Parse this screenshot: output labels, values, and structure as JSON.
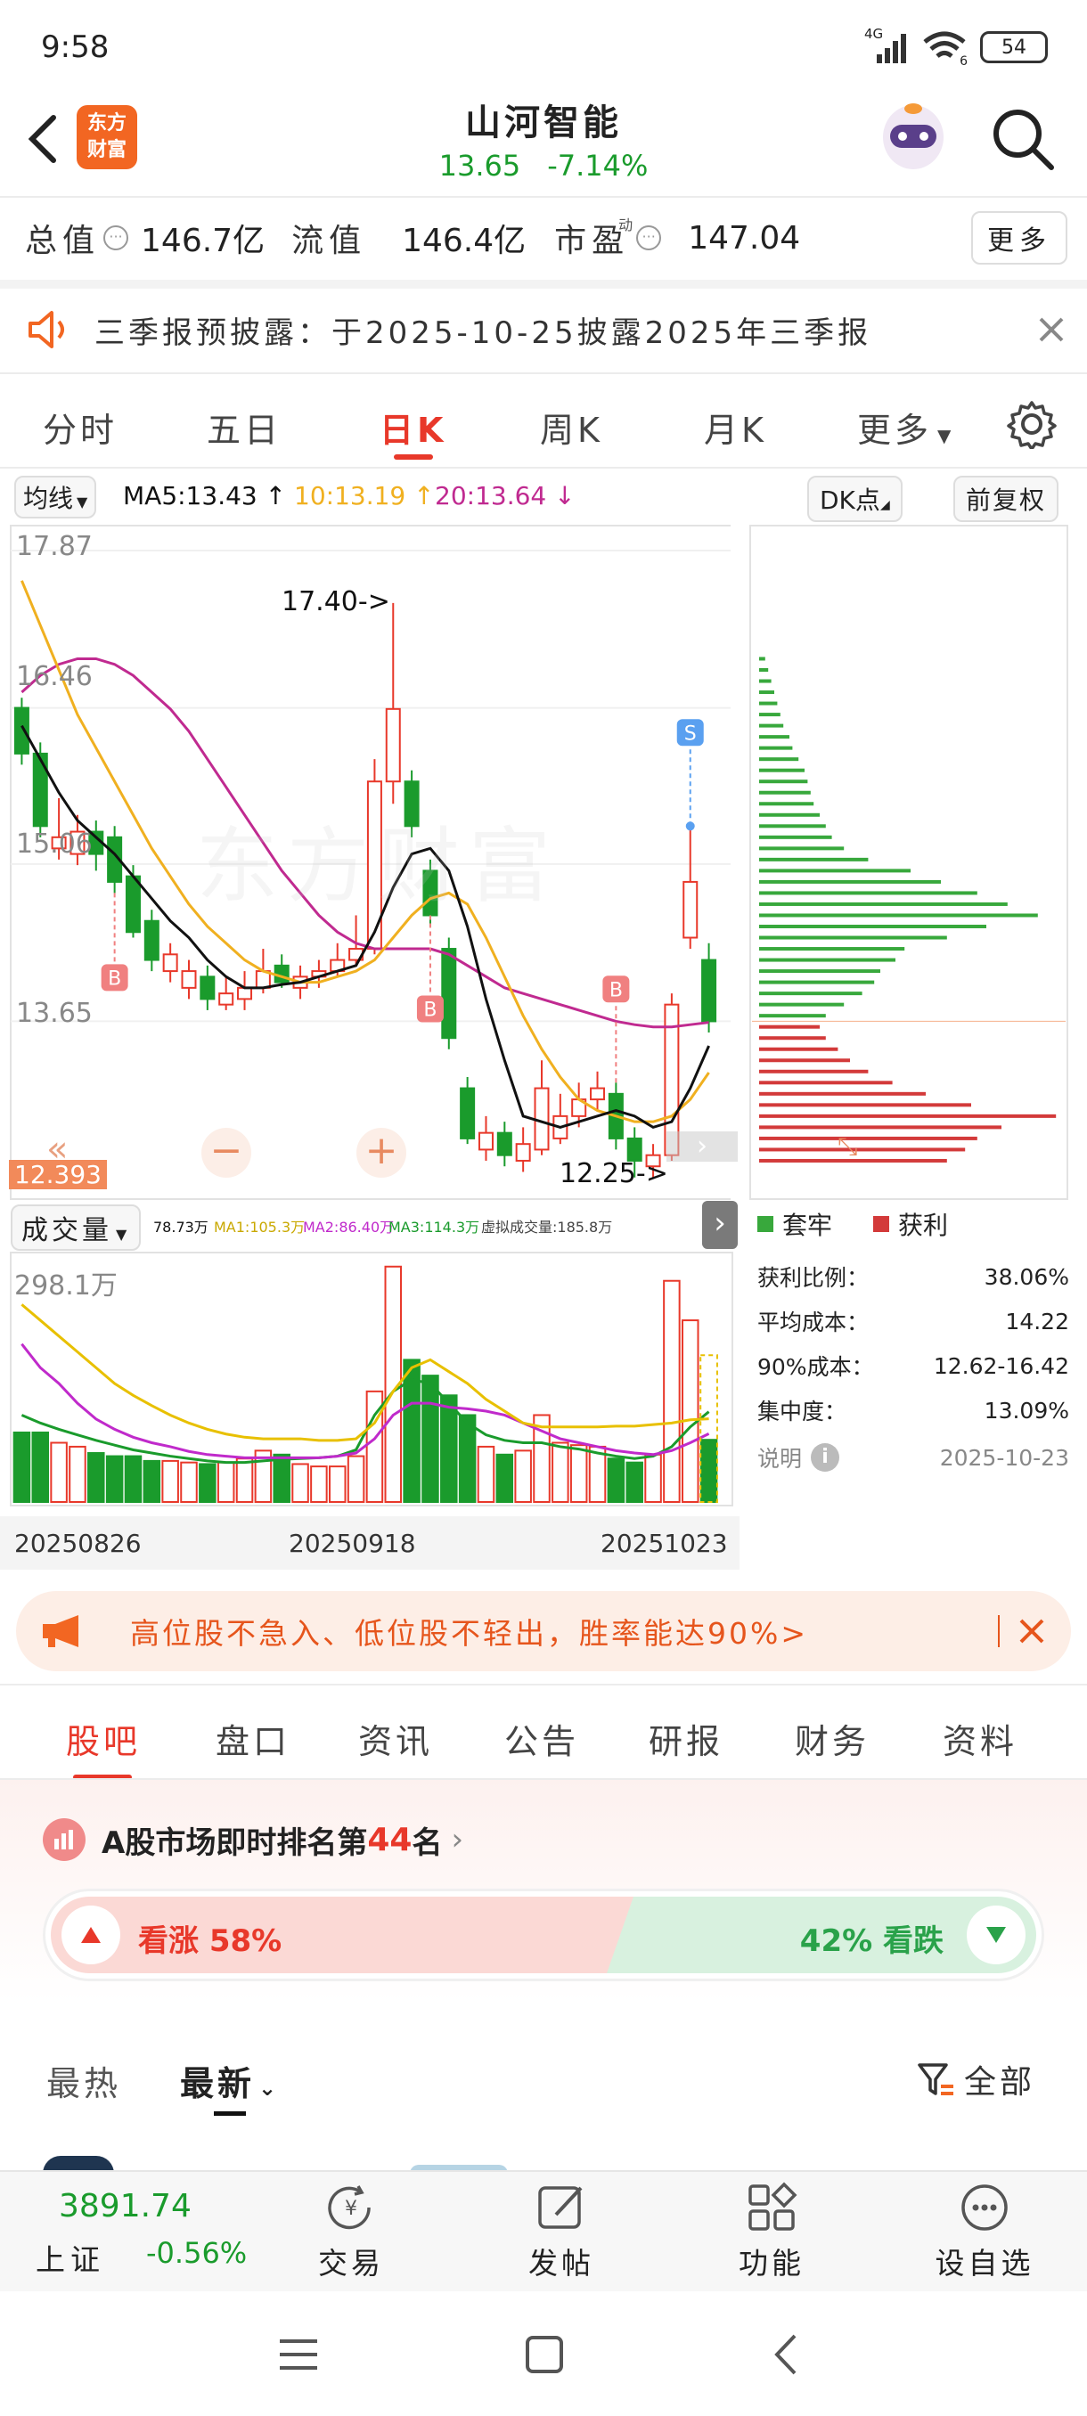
{
  "status_bar": {
    "time": "9:58",
    "network": "4G",
    "wifi_badge": "6",
    "battery": "54"
  },
  "header": {
    "brand_logo_text": "东方财富",
    "title": "山河智能",
    "price": "13.65",
    "change": "-7.14%"
  },
  "stats": {
    "total_label": "总值",
    "total_value": "146.7亿",
    "float_label": "流值",
    "float_value": "146.4亿",
    "pe_label": "市盈",
    "pe_superscript": "动",
    "pe_value": "147.04",
    "more_label": "更多"
  },
  "notice": {
    "text": "三季报预披露：于2025-10-25披露2025年三季报"
  },
  "chart_tabs": [
    "分时",
    "五日",
    "日K",
    "周K",
    "月K",
    "更多"
  ],
  "indicator_bar": {
    "ma_selector": "均线",
    "ma5": "MA5:13.43",
    "ma10": "10:13.19",
    "ma20": "20:13.64",
    "dk_button": "DK点",
    "adjust_button": "前复权"
  },
  "price_axis": [
    "17.87",
    "16.46",
    "15.06",
    "13.65",
    "12.393"
  ],
  "annotations": {
    "high": "17.40->",
    "low": "12.25->",
    "buy_marker": "B",
    "sell_marker": "S",
    "watermark": "东方财富"
  },
  "volume_bar": {
    "label": "成交量",
    "vol": "78.73万",
    "ma1": "MA1:105.3万",
    "ma2": "MA2:86.40万",
    "ma3": "MA3:114.3万",
    "virtual": "虚拟成交量:185.8万",
    "axis_max": "298.1万"
  },
  "dates": [
    "20250826",
    "20250918",
    "20251023"
  ],
  "chip_panel": {
    "legend_trapped": "套牢",
    "legend_profit": "获利",
    "rows": [
      {
        "label": "获利比例：",
        "value": "38.06%"
      },
      {
        "label": "平均成本：",
        "value": "14.22"
      },
      {
        "label": "90%成本：",
        "value": "12.62-16.42"
      },
      {
        "label": "集中度：",
        "value": "13.09%"
      }
    ],
    "explain": "说明",
    "date": "2025-10-23"
  },
  "promo": {
    "text": "高位股不急入、低位股不轻出，胜率能达90%>"
  },
  "section_tabs": [
    "股吧",
    "盘口",
    "资讯",
    "公告",
    "研报",
    "财务",
    "资料"
  ],
  "ranking": {
    "prefix": "A股市场即时排名第",
    "rank": "44",
    "suffix": "名"
  },
  "sentiment": {
    "up_label": "看涨 58%",
    "down_label": "42% 看跌",
    "up_fraction": 0.58
  },
  "feed_filter": {
    "hot": "最热",
    "latest": "最新",
    "all": "全部"
  },
  "bottom_bar": {
    "index_value": "3891.74",
    "index_name": "上证",
    "index_change": "-0.56%",
    "trade": "交易",
    "post": "发帖",
    "functions": "功能",
    "watchlist": "设自选"
  },
  "colors": {
    "up": "#e8382a",
    "down": "#1a9b2c",
    "ma5": "#111111",
    "ma10": "#f0b020",
    "ma20": "#c02a90",
    "accent": "#e8382a"
  },
  "chart_data": {
    "type": "candlestick",
    "candles": [
      {
        "o": 16.46,
        "c": 16.05,
        "h": 16.55,
        "l": 15.95
      },
      {
        "o": 16.05,
        "c": 15.4,
        "h": 16.15,
        "l": 15.3
      },
      {
        "o": 15.2,
        "c": 15.3,
        "h": 15.65,
        "l": 15.1
      },
      {
        "o": 15.15,
        "c": 15.35,
        "h": 15.5,
        "l": 15.05
      },
      {
        "o": 15.35,
        "c": 15.15,
        "h": 15.45,
        "l": 15.0
      },
      {
        "o": 15.3,
        "c": 14.9,
        "h": 15.4,
        "l": 14.8
      },
      {
        "o": 14.95,
        "c": 14.45,
        "h": 15.05,
        "l": 14.4
      },
      {
        "o": 14.55,
        "c": 14.2,
        "h": 14.65,
        "l": 14.1
      },
      {
        "o": 14.1,
        "c": 14.25,
        "h": 14.35,
        "l": 14.0
      },
      {
        "o": 13.95,
        "c": 14.1,
        "h": 14.2,
        "l": 13.85
      },
      {
        "o": 14.05,
        "c": 13.85,
        "h": 14.15,
        "l": 13.75
      },
      {
        "o": 13.8,
        "c": 13.9,
        "h": 14.05,
        "l": 13.75
      },
      {
        "o": 13.85,
        "c": 13.95,
        "h": 14.1,
        "l": 13.75
      },
      {
        "o": 13.95,
        "c": 14.1,
        "h": 14.3,
        "l": 13.9
      },
      {
        "o": 14.15,
        "c": 14.0,
        "h": 14.25,
        "l": 13.95
      },
      {
        "o": 13.95,
        "c": 14.05,
        "h": 14.15,
        "l": 13.85
      },
      {
        "o": 14.05,
        "c": 14.1,
        "h": 14.2,
        "l": 13.95
      },
      {
        "o": 14.1,
        "c": 14.2,
        "h": 14.35,
        "l": 14.05
      },
      {
        "o": 14.2,
        "c": 14.3,
        "h": 14.6,
        "l": 14.15
      },
      {
        "o": 14.3,
        "c": 15.8,
        "h": 16.0,
        "l": 14.25
      },
      {
        "o": 15.8,
        "c": 16.45,
        "h": 17.4,
        "l": 15.6
      },
      {
        "o": 15.8,
        "c": 15.4,
        "h": 15.9,
        "l": 15.3
      },
      {
        "o": 15.0,
        "c": 14.6,
        "h": 15.1,
        "l": 14.5
      },
      {
        "o": 14.3,
        "c": 13.5,
        "h": 14.4,
        "l": 13.4
      },
      {
        "o": 13.05,
        "c": 12.6,
        "h": 13.15,
        "l": 12.55
      },
      {
        "o": 12.5,
        "c": 12.65,
        "h": 12.8,
        "l": 12.4
      },
      {
        "o": 12.65,
        "c": 12.45,
        "h": 12.75,
        "l": 12.35
      },
      {
        "o": 12.4,
        "c": 12.55,
        "h": 12.7,
        "l": 12.3
      },
      {
        "o": 12.5,
        "c": 13.05,
        "h": 13.3,
        "l": 12.45
      },
      {
        "o": 12.6,
        "c": 12.8,
        "h": 13.0,
        "l": 12.55
      },
      {
        "o": 12.8,
        "c": 12.95,
        "h": 13.1,
        "l": 12.7
      },
      {
        "o": 12.95,
        "c": 13.05,
        "h": 13.2,
        "l": 12.85
      },
      {
        "o": 13.0,
        "c": 12.6,
        "h": 13.1,
        "l": 12.5
      },
      {
        "o": 12.6,
        "c": 12.4,
        "h": 12.7,
        "l": 12.25
      },
      {
        "o": 12.35,
        "c": 12.45,
        "h": 12.55,
        "l": 12.25
      },
      {
        "o": 12.45,
        "c": 13.8,
        "h": 13.9,
        "l": 12.4
      },
      {
        "o": 14.4,
        "c": 14.9,
        "h": 15.4,
        "l": 14.3
      },
      {
        "o": 14.2,
        "c": 13.65,
        "h": 14.35,
        "l": 13.55
      }
    ],
    "ma5": [
      16.3,
      16.0,
      15.7,
      15.45,
      15.3,
      15.15,
      14.95,
      14.75,
      14.55,
      14.4,
      14.2,
      14.05,
      13.95,
      13.95,
      13.98,
      14.0,
      14.05,
      14.1,
      14.15,
      14.45,
      14.85,
      15.15,
      15.2,
      15.0,
      14.5,
      13.85,
      13.3,
      12.8,
      12.75,
      12.7,
      12.75,
      12.8,
      12.85,
      12.8,
      12.7,
      12.75,
      13.05,
      13.43
    ],
    "ma10": [
      17.6,
      17.2,
      16.8,
      16.4,
      16.1,
      15.8,
      15.5,
      15.2,
      14.95,
      14.7,
      14.5,
      14.35,
      14.2,
      14.1,
      14.05,
      14.0,
      14.0,
      14.05,
      14.1,
      14.2,
      14.4,
      14.6,
      14.75,
      14.8,
      14.7,
      14.4,
      14.05,
      13.7,
      13.4,
      13.15,
      12.95,
      12.85,
      12.8,
      12.75,
      12.75,
      12.8,
      12.95,
      13.19
    ],
    "ma20": [
      16.6,
      16.75,
      16.85,
      16.9,
      16.9,
      16.85,
      16.75,
      16.6,
      16.45,
      16.25,
      16.0,
      15.75,
      15.5,
      15.25,
      15.0,
      14.8,
      14.6,
      14.45,
      14.35,
      14.3,
      14.3,
      14.3,
      14.3,
      14.25,
      14.15,
      14.05,
      13.95,
      13.9,
      13.85,
      13.8,
      13.75,
      13.7,
      13.65,
      13.62,
      13.6,
      13.6,
      13.62,
      13.64
    ],
    "volume": [
      88,
      88,
      75,
      70,
      62,
      58,
      58,
      52,
      52,
      50,
      48,
      50,
      55,
      65,
      60,
      48,
      45,
      45,
      58,
      140,
      298,
      180,
      160,
      135,
      110,
      70,
      60,
      65,
      110,
      75,
      72,
      70,
      55,
      50,
      60,
      280,
      230,
      78.73
    ],
    "vol_ma": {
      "ma1": [
        250,
        230,
        210,
        190,
        170,
        150,
        135,
        122,
        110,
        100,
        92,
        86,
        82,
        80,
        80,
        80,
        78,
        78,
        80,
        100,
        140,
        170,
        180,
        165,
        150,
        130,
        115,
        100,
        95,
        95,
        95,
        95,
        96,
        96,
        98,
        100,
        104,
        105.3
      ],
      "ma2": [
        200,
        170,
        150,
        125,
        105,
        92,
        82,
        75,
        70,
        64,
        60,
        58,
        56,
        56,
        56,
        56,
        56,
        58,
        62,
        80,
        110,
        125,
        125,
        120,
        118,
        115,
        110,
        100,
        90,
        80,
        75,
        70,
        65,
        62,
        60,
        65,
        75,
        86.4
      ],
      "ma3": [
        110,
        100,
        92,
        85,
        78,
        72,
        66,
        62,
        58,
        55,
        52,
        50,
        50,
        52,
        54,
        55,
        56,
        58,
        66,
        110,
        140,
        155,
        150,
        125,
        100,
        85,
        78,
        75,
        75,
        70,
        67,
        62,
        58,
        55,
        58,
        70,
        95,
        114.3
      ]
    },
    "chip_bars": [
      {
        "p": 16.9,
        "w": 2,
        "t": "trapped"
      },
      {
        "p": 16.8,
        "w": 3,
        "t": "trapped"
      },
      {
        "p": 16.7,
        "w": 4,
        "t": "trapped"
      },
      {
        "p": 16.6,
        "w": 5,
        "t": "trapped"
      },
      {
        "p": 16.5,
        "w": 6,
        "t": "trapped"
      },
      {
        "p": 16.4,
        "w": 7,
        "t": "trapped"
      },
      {
        "p": 16.3,
        "w": 8,
        "t": "trapped"
      },
      {
        "p": 16.2,
        "w": 10,
        "t": "trapped"
      },
      {
        "p": 16.1,
        "w": 11,
        "t": "trapped"
      },
      {
        "p": 16.0,
        "w": 13,
        "t": "trapped"
      },
      {
        "p": 15.9,
        "w": 15,
        "t": "trapped"
      },
      {
        "p": 15.8,
        "w": 16,
        "t": "trapped"
      },
      {
        "p": 15.7,
        "w": 17,
        "t": "trapped"
      },
      {
        "p": 15.6,
        "w": 18,
        "t": "trapped"
      },
      {
        "p": 15.5,
        "w": 20,
        "t": "trapped"
      },
      {
        "p": 15.4,
        "w": 22,
        "t": "trapped"
      },
      {
        "p": 15.3,
        "w": 24,
        "t": "trapped"
      },
      {
        "p": 15.2,
        "w": 28,
        "t": "trapped"
      },
      {
        "p": 15.1,
        "w": 36,
        "t": "trapped"
      },
      {
        "p": 15.0,
        "w": 50,
        "t": "trapped"
      },
      {
        "p": 14.9,
        "w": 60,
        "t": "trapped"
      },
      {
        "p": 14.8,
        "w": 72,
        "t": "trapped"
      },
      {
        "p": 14.7,
        "w": 82,
        "t": "trapped"
      },
      {
        "p": 14.6,
        "w": 92,
        "t": "trapped"
      },
      {
        "p": 14.5,
        "w": 75,
        "t": "trapped"
      },
      {
        "p": 14.4,
        "w": 62,
        "t": "trapped"
      },
      {
        "p": 14.3,
        "w": 48,
        "t": "trapped"
      },
      {
        "p": 14.2,
        "w": 45,
        "t": "trapped"
      },
      {
        "p": 14.1,
        "w": 40,
        "t": "trapped"
      },
      {
        "p": 14.0,
        "w": 38,
        "t": "trapped"
      },
      {
        "p": 13.9,
        "w": 34,
        "t": "trapped"
      },
      {
        "p": 13.8,
        "w": 28,
        "t": "trapped"
      },
      {
        "p": 13.7,
        "w": 22,
        "t": "trapped"
      },
      {
        "p": 13.6,
        "w": 20,
        "t": "profit"
      },
      {
        "p": 13.5,
        "w": 22,
        "t": "profit"
      },
      {
        "p": 13.4,
        "w": 26,
        "t": "profit"
      },
      {
        "p": 13.3,
        "w": 30,
        "t": "profit"
      },
      {
        "p": 13.2,
        "w": 36,
        "t": "profit"
      },
      {
        "p": 13.1,
        "w": 44,
        "t": "profit"
      },
      {
        "p": 13.0,
        "w": 55,
        "t": "profit"
      },
      {
        "p": 12.9,
        "w": 70,
        "t": "profit"
      },
      {
        "p": 12.8,
        "w": 98,
        "t": "profit"
      },
      {
        "p": 12.7,
        "w": 80,
        "t": "profit"
      },
      {
        "p": 12.6,
        "w": 72,
        "t": "profit"
      },
      {
        "p": 12.5,
        "w": 68,
        "t": "profit"
      },
      {
        "p": 12.4,
        "w": 62,
        "t": "profit"
      }
    ],
    "price_range": [
      12.25,
      17.87
    ]
  }
}
